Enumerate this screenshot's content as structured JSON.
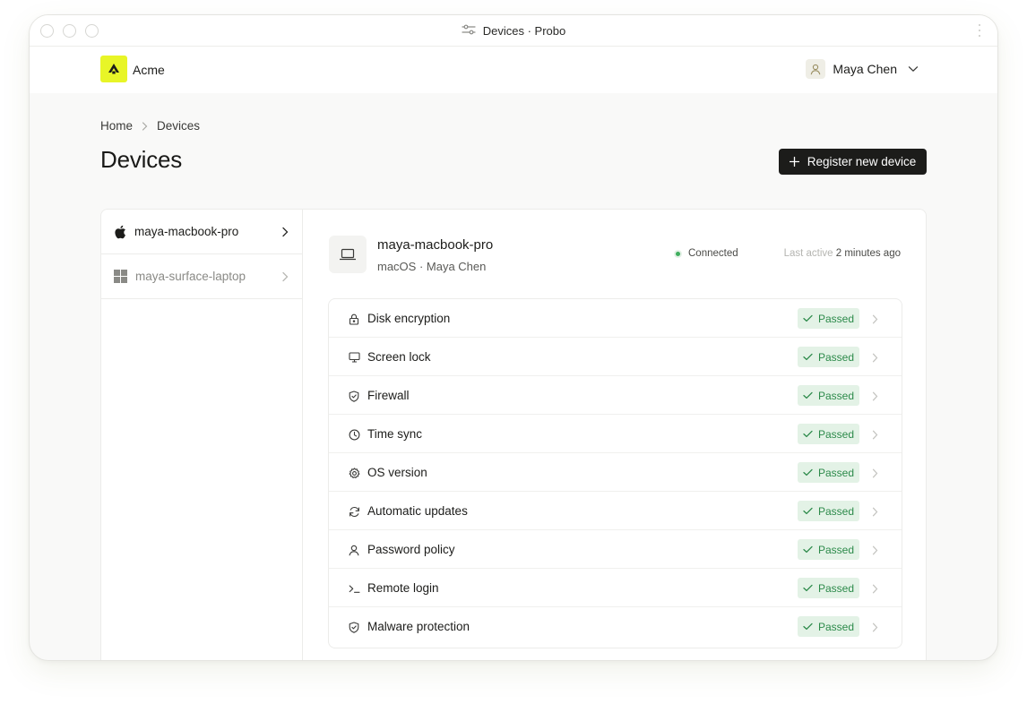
{
  "window": {
    "title": "Devices · Probo"
  },
  "org": {
    "name": "Acme"
  },
  "user": {
    "name": "Maya Chen"
  },
  "breadcrumb": {
    "home": "Home",
    "current": "Devices"
  },
  "page": {
    "title": "Devices",
    "register_label": "Register new device"
  },
  "sidebar": {
    "devices": [
      {
        "name": "maya-macbook-pro",
        "os_icon": "apple-icon",
        "active": true
      },
      {
        "name": "maya-surface-laptop",
        "os_icon": "windows-icon",
        "active": false
      }
    ]
  },
  "device": {
    "name": "maya-macbook-pro",
    "subtitle": "macOS · Maya Chen",
    "status": "Connected",
    "status_color": "#3fae5e",
    "last_active_label": "Last active",
    "last_active_value": "2 minutes ago"
  },
  "checks": [
    {
      "label": "Disk encryption",
      "icon": "lock-icon",
      "status": "Passed"
    },
    {
      "label": "Screen lock",
      "icon": "monitor-icon",
      "status": "Passed"
    },
    {
      "label": "Firewall",
      "icon": "shield-check-icon",
      "status": "Passed"
    },
    {
      "label": "Time sync",
      "icon": "clock-icon",
      "status": "Passed"
    },
    {
      "label": "OS version",
      "icon": "gear-icon",
      "status": "Passed"
    },
    {
      "label": "Automatic updates",
      "icon": "refresh-icon",
      "status": "Passed"
    },
    {
      "label": "Password policy",
      "icon": "user-icon",
      "status": "Passed"
    },
    {
      "label": "Remote login",
      "icon": "terminal-icon",
      "status": "Passed"
    },
    {
      "label": "Malware protection",
      "icon": "shield-check-icon",
      "status": "Passed"
    }
  ],
  "colors": {
    "brand": "#e8f527",
    "passed_bg": "#e3f2e6",
    "passed_text": "#2c8a4a",
    "primary_button": "#1c1c1a"
  }
}
